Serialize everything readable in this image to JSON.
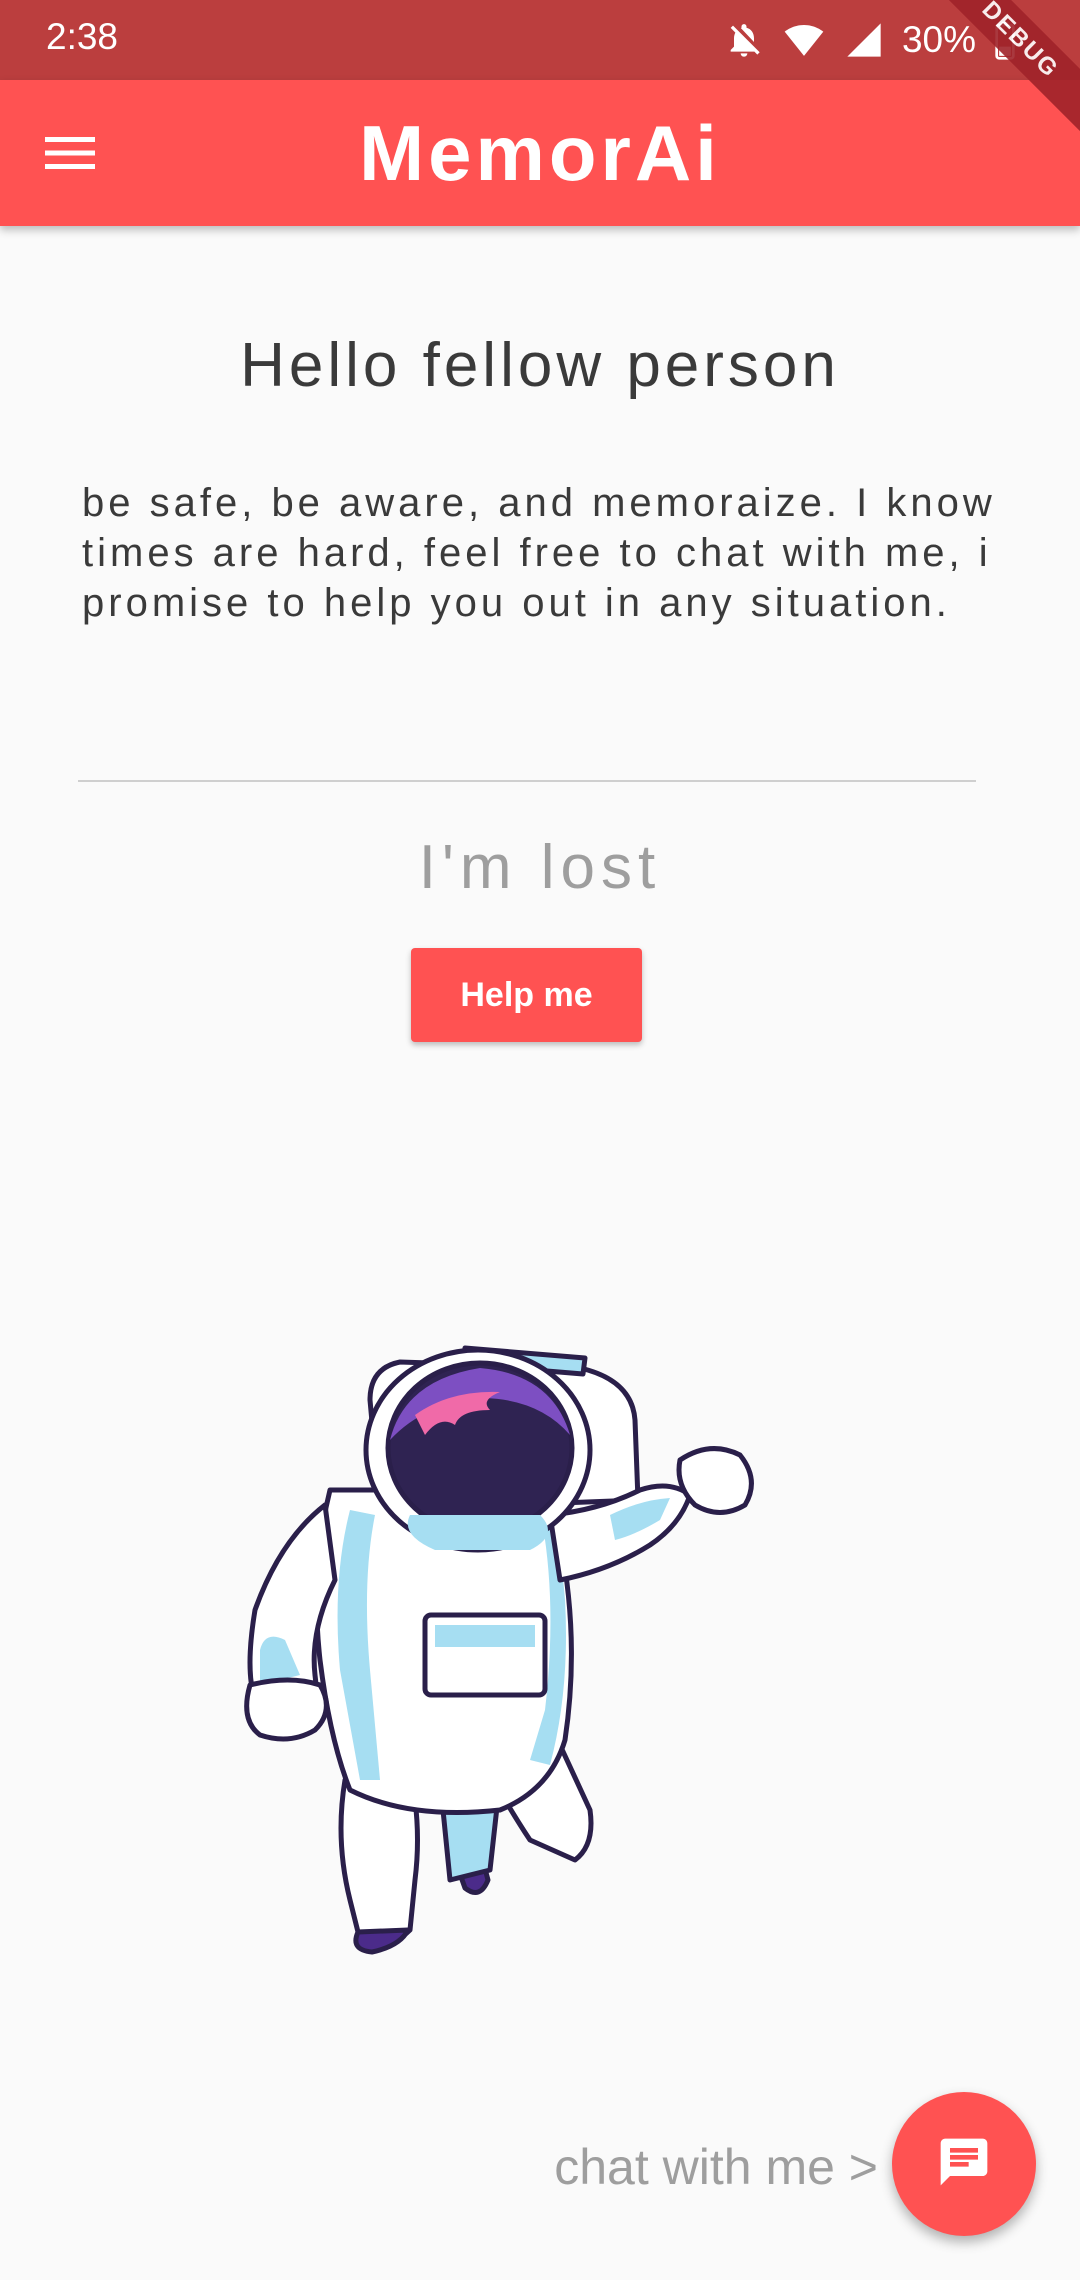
{
  "status_bar": {
    "time": "2:38",
    "battery": "30%",
    "icons": [
      "bell-off-icon",
      "wifi-icon",
      "signal-icon",
      "battery-icon"
    ]
  },
  "app_bar": {
    "title": "MemorAi",
    "menu_icon": "menu-icon",
    "background": "#ff5252"
  },
  "debug_banner": "DEBUG",
  "main": {
    "greeting": "Hello fellow person",
    "intro": "be safe, be aware, and memoraize. I know times are hard, feel free to chat with me, i promise to help you out in any situation.",
    "lost_heading": "I'm lost",
    "help_button": "Help me",
    "illustration": "astronaut-illustration"
  },
  "chat": {
    "label": "chat with me >",
    "fab_icon": "chat-icon"
  },
  "colors": {
    "accent": "#ff5252",
    "status_bar": "#bb3e3e",
    "text_dark": "#3a3a3a",
    "text_muted": "#9e9e9e"
  }
}
